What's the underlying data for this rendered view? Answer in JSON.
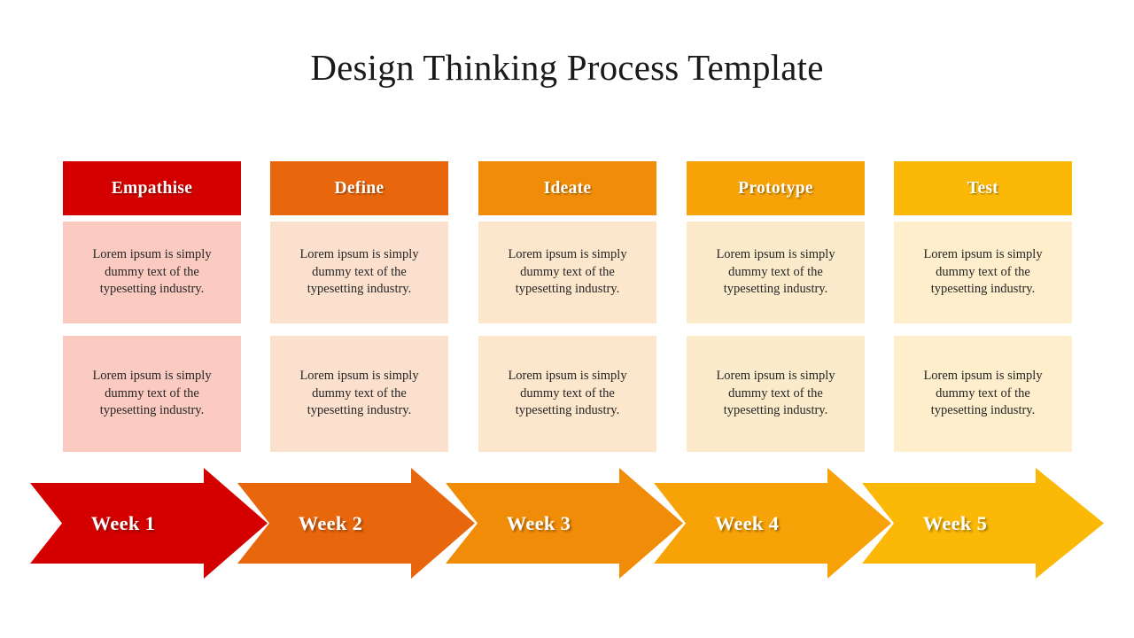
{
  "slide": {
    "title": "Design Thinking Process Template",
    "background": "#FFFFFF"
  },
  "columns": [
    {
      "header_label": "Empathise",
      "header_color": "#D40000",
      "body_color": "#FBCBC1",
      "body_text_1": "Lorem ipsum is simply dummy text of the typesetting industry.",
      "body_text_2": "Lorem ipsum is simply dummy text of the typesetting industry."
    },
    {
      "header_label": "Define",
      "header_color": "#E8660C",
      "body_color": "#FBE0CE",
      "body_text_1": "Lorem ipsum is simply dummy text of the typesetting industry.",
      "body_text_2": "Lorem ipsum is simply dummy text of the typesetting industry."
    },
    {
      "header_label": "Ideate",
      "header_color": "#F08C07",
      "body_color": "#FCE6CC",
      "body_text_1": "Lorem ipsum is simply dummy text of the typesetting industry.",
      "body_text_2": "Lorem ipsum is simply dummy text of the typesetting industry."
    },
    {
      "header_label": "Prototype",
      "header_color": "#F7A206",
      "body_color": "#FCEBCB",
      "body_text_1": "Lorem ipsum is simply dummy text of the typesetting industry.",
      "body_text_2": "Lorem ipsum is simply dummy text of the typesetting industry."
    },
    {
      "header_label": "Test",
      "header_color": "#FBB806",
      "body_color": "#FEEECC",
      "body_text_1": "Lorem ipsum is simply dummy text of the typesetting industry.",
      "body_text_2": "Lorem ipsum is simply dummy text of the typesetting industry."
    }
  ],
  "timeline": [
    {
      "label": "Week 1",
      "color": "#D40000"
    },
    {
      "label": "Week 2",
      "color": "#E8660C"
    },
    {
      "label": "Week 3",
      "color": "#F08C07"
    },
    {
      "label": "Week 4",
      "color": "#F7A206"
    },
    {
      "label": "Week 5",
      "color": "#FBB806"
    }
  ]
}
